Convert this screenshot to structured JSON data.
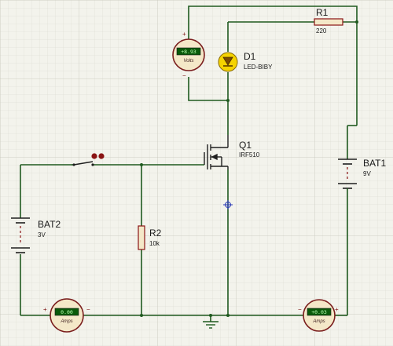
{
  "components": {
    "r1": {
      "ref": "R1",
      "value": "220"
    },
    "d1": {
      "ref": "D1",
      "value": "LED-BIBY"
    },
    "q1": {
      "ref": "Q1",
      "value": "IRF510"
    },
    "bat1": {
      "ref": "BAT1",
      "value": "9V"
    },
    "bat2": {
      "ref": "BAT2",
      "value": "3V"
    },
    "r2": {
      "ref": "R2",
      "value": "10k"
    }
  },
  "meters": {
    "voltmeter": {
      "reading": "+8.93",
      "unit": "Volts",
      "plus": "+",
      "minus": "−"
    },
    "ammeter_left": {
      "reading": "0.00",
      "unit": "Amps",
      "plus": "+",
      "minus": "−"
    },
    "ammeter_right": {
      "reading": "+0.03",
      "unit": "Amps",
      "plus": "+",
      "minus": "−"
    }
  },
  "colors": {
    "wire": "#1f5a1f",
    "meter_body": "#f4e8c8",
    "meter_border": "#7a1d1d",
    "lcd": "#0a5a0a",
    "led_yellow": "#f5d300",
    "grid": "#d9d9cf"
  }
}
